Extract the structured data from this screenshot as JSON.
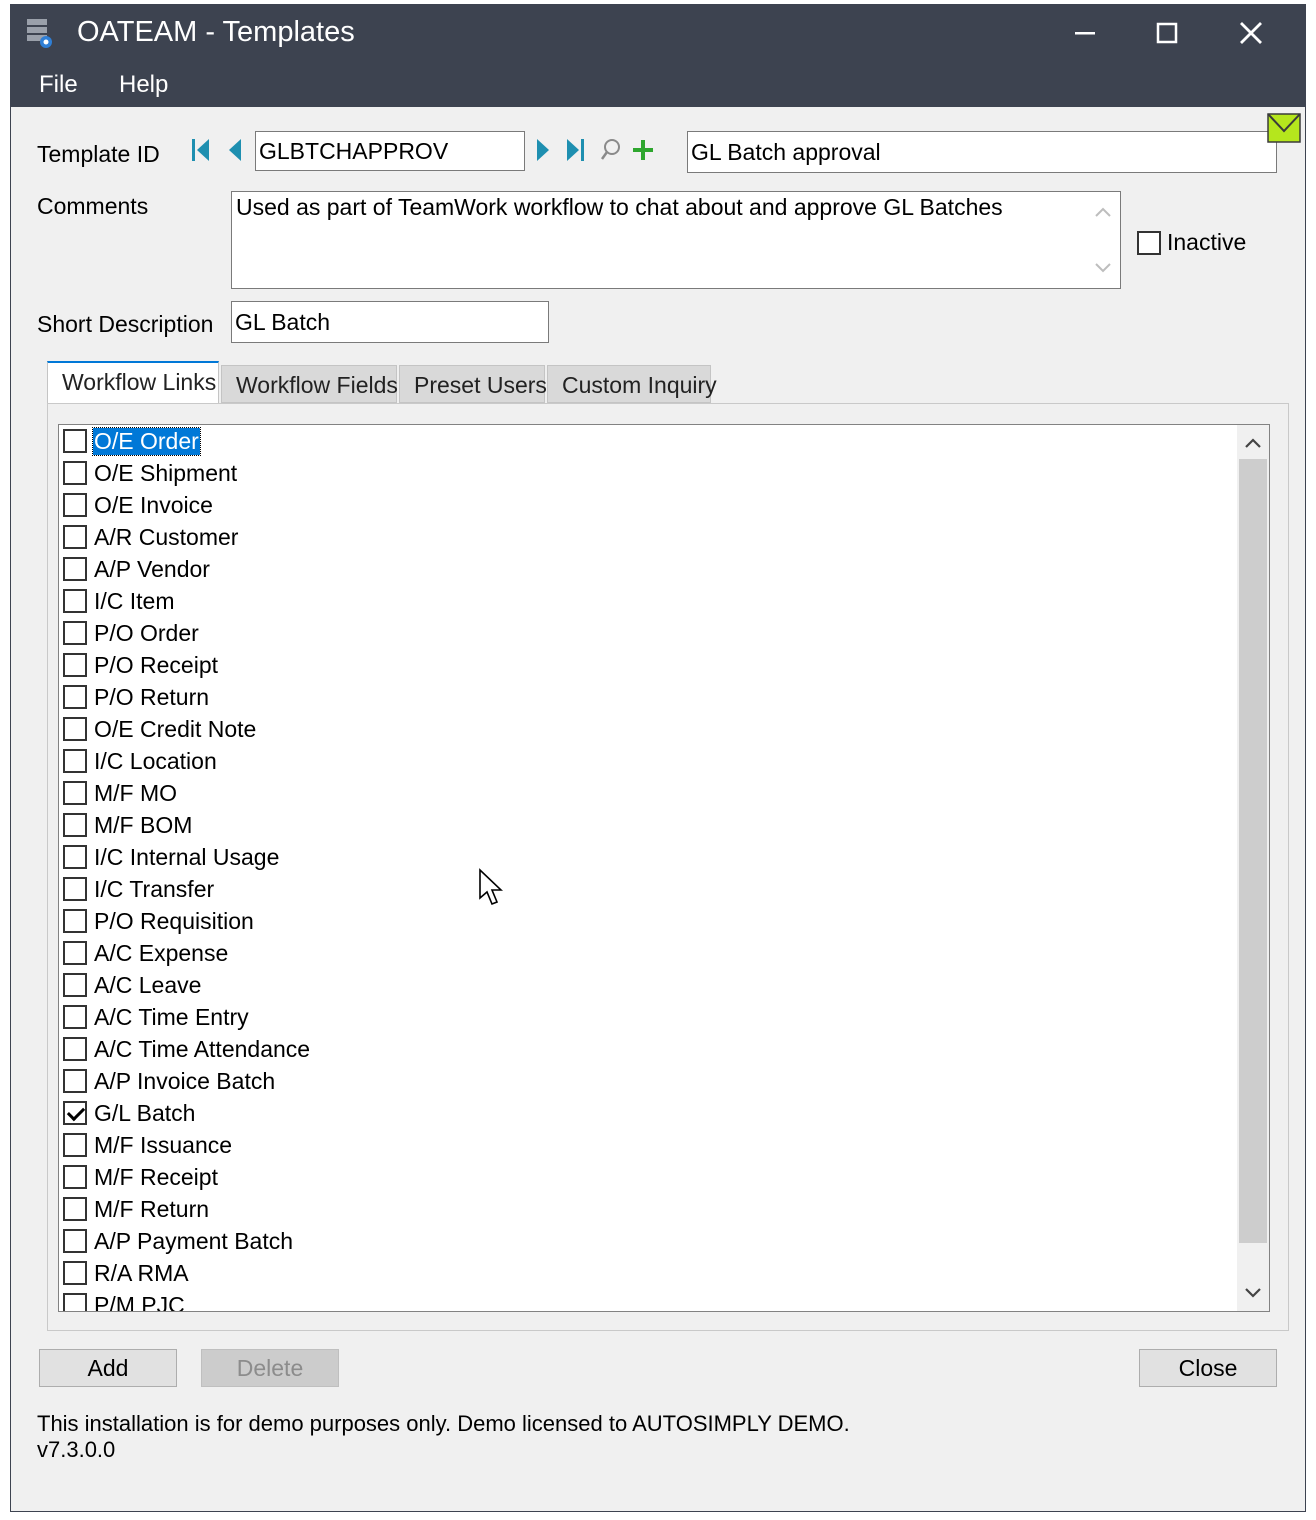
{
  "window": {
    "title": "OATEAM - Templates"
  },
  "menu": {
    "items": [
      {
        "label": "File"
      },
      {
        "label": "Help"
      }
    ]
  },
  "form": {
    "template_id_label": "Template ID",
    "template_id_value": "GLBTCHAPPROV",
    "description_value": "GL Batch approval",
    "comments_label": "Comments",
    "comments_value": "Used as part of TeamWork workflow to chat about and approve GL Batches",
    "inactive_label": "Inactive",
    "inactive_checked": false,
    "short_description_label": "Short Description",
    "short_description_value": "GL Batch"
  },
  "tabs": [
    {
      "label": "Workflow Links",
      "active": true
    },
    {
      "label": "Workflow Fields",
      "active": false
    },
    {
      "label": "Preset Users",
      "active": false
    },
    {
      "label": "Custom Inquiry",
      "active": false
    }
  ],
  "workflow_links": [
    {
      "label": "O/E Order",
      "checked": false,
      "selected": true
    },
    {
      "label": "O/E Shipment",
      "checked": false
    },
    {
      "label": "O/E Invoice",
      "checked": false
    },
    {
      "label": "A/R Customer",
      "checked": false
    },
    {
      "label": "A/P Vendor",
      "checked": false
    },
    {
      "label": "I/C Item",
      "checked": false
    },
    {
      "label": "P/O Order",
      "checked": false
    },
    {
      "label": "P/O Receipt",
      "checked": false
    },
    {
      "label": "P/O Return",
      "checked": false
    },
    {
      "label": "O/E Credit Note",
      "checked": false
    },
    {
      "label": "I/C Location",
      "checked": false
    },
    {
      "label": "M/F MO",
      "checked": false
    },
    {
      "label": "M/F BOM",
      "checked": false
    },
    {
      "label": "I/C Internal Usage",
      "checked": false
    },
    {
      "label": "I/C Transfer",
      "checked": false
    },
    {
      "label": "P/O Requisition",
      "checked": false
    },
    {
      "label": "A/C Expense",
      "checked": false
    },
    {
      "label": "A/C Leave",
      "checked": false
    },
    {
      "label": "A/C Time Entry",
      "checked": false
    },
    {
      "label": "A/C Time Attendance",
      "checked": false
    },
    {
      "label": "A/P Invoice Batch",
      "checked": false
    },
    {
      "label": "G/L Batch",
      "checked": true
    },
    {
      "label": "M/F Issuance",
      "checked": false
    },
    {
      "label": "M/F Receipt",
      "checked": false
    },
    {
      "label": "M/F Return",
      "checked": false
    },
    {
      "label": "A/P Payment Batch",
      "checked": false
    },
    {
      "label": "R/A RMA",
      "checked": false
    },
    {
      "label": "P/M PJC",
      "checked": false
    }
  ],
  "buttons": {
    "add": "Add",
    "delete": "Delete",
    "close": "Close"
  },
  "footer": {
    "license_text": "This installation is for demo purposes only. Demo licensed to AUTOSIMPLY DEMO.",
    "version": "v7.3.0.0"
  },
  "colors": {
    "titlebar": "#3d4350",
    "accent": "#0078d7",
    "mail_icon": "#b5e61d"
  },
  "icons": {
    "app": "app-icon",
    "first": "first-record-icon",
    "previous": "previous-record-icon",
    "next": "next-record-icon",
    "last": "last-record-icon",
    "finder": "finder-icon",
    "new": "new-record-icon",
    "mail": "mail-icon"
  }
}
